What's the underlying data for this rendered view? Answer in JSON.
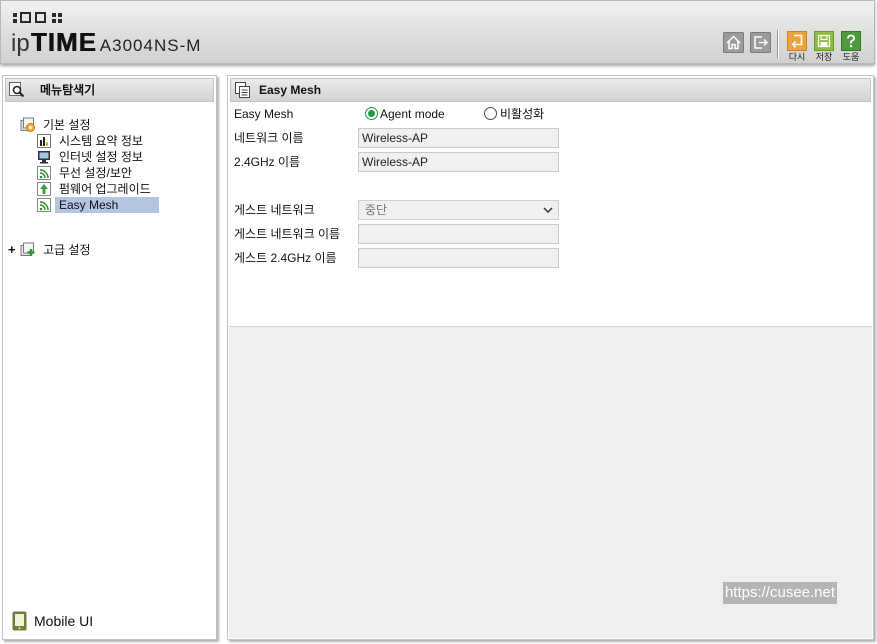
{
  "header": {
    "brand_ip": "ip",
    "brand_time": "TIME",
    "model": "A3004NS-M",
    "nav_icons": [
      "home-icon",
      "logout-icon"
    ],
    "actions": [
      {
        "label": "다시",
        "icon": "restart-icon",
        "color": "#eaa43c"
      },
      {
        "label": "저장",
        "icon": "save-icon",
        "color": "#8fbd42"
      },
      {
        "label": "도움",
        "icon": "help-icon",
        "color": "#4e9a3c"
      }
    ]
  },
  "sidebar": {
    "title": "메뉴탐색기",
    "title_icon": "magnifier-icon",
    "tree": {
      "basic": {
        "label": "기본 설정",
        "icon": "folder-settings-icon",
        "expanded": true,
        "children": [
          {
            "label": "시스템 요약 정보",
            "icon": "chart-icon",
            "selected": false
          },
          {
            "label": "인터넷 설정 정보",
            "icon": "monitor-icon",
            "selected": false
          },
          {
            "label": "무선 설정/보안",
            "icon": "wifi-icon",
            "selected": false
          },
          {
            "label": "펌웨어 업그레이드",
            "icon": "upgrade-icon",
            "selected": false
          },
          {
            "label": "Easy Mesh",
            "icon": "wifi-icon",
            "selected": true
          }
        ]
      },
      "advanced": {
        "label": "고급 설정",
        "icon": "folder-add-icon",
        "expander": "+",
        "expanded": false
      }
    },
    "mobile_ui": {
      "label": "Mobile UI",
      "icon": "mobile-phone-icon"
    }
  },
  "main": {
    "title": "Easy Mesh",
    "title_icon": "pages-icon",
    "form": {
      "easy_mesh": {
        "label": "Easy Mesh",
        "options": [
          {
            "label": "Agent mode",
            "checked": true
          },
          {
            "label": "비활성화",
            "checked": false
          }
        ]
      },
      "network_name": {
        "label": "네트워크 이름",
        "value": "Wireless-AP"
      },
      "name_24ghz": {
        "label": "2.4GHz 이름",
        "value": "Wireless-AP"
      },
      "guest_network": {
        "label": "게스트 네트워크",
        "value": "중단"
      },
      "guest_network_name": {
        "label": "게스트 네트워크 이름",
        "value": ""
      },
      "guest_name_24ghz": {
        "label": "게스트 2.4GHz 이름",
        "value": ""
      }
    }
  },
  "watermark": "https://cusee.net",
  "colors": {
    "selected_bg": "#b4c4e2",
    "radio_accent": "#1f9a3c",
    "panel_header": "#d9d9d9",
    "lower_area": "#efefef"
  }
}
